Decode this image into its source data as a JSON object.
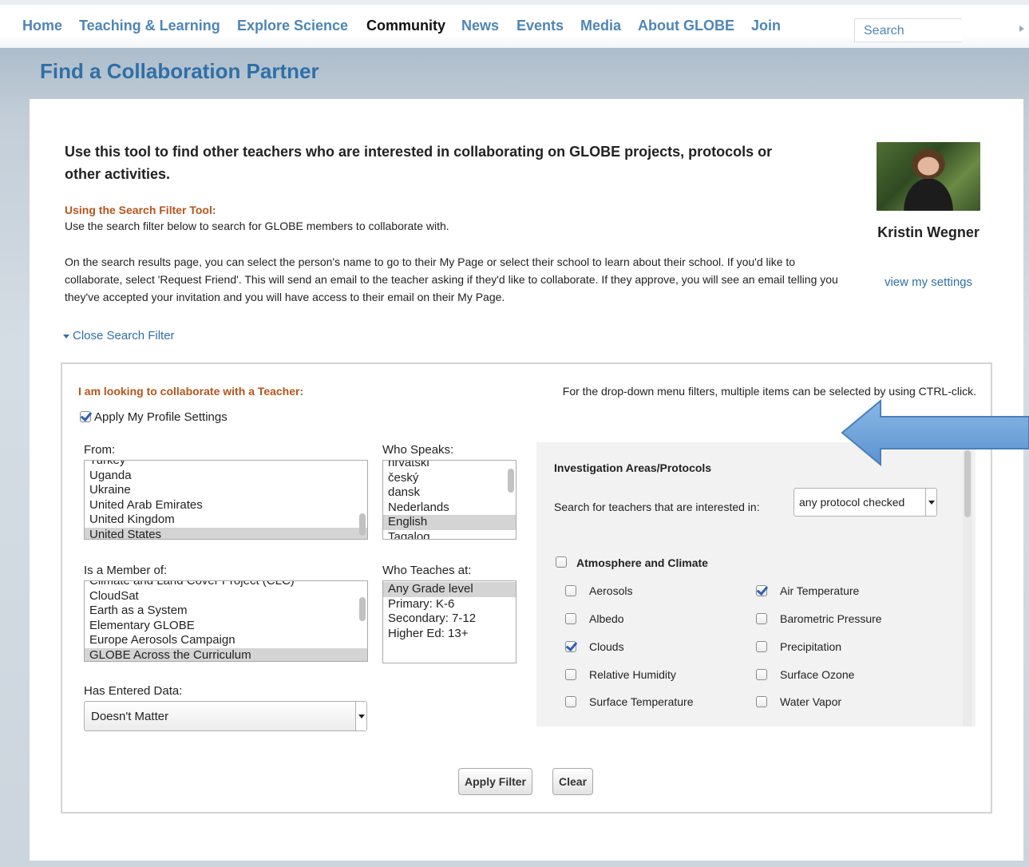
{
  "nav": {
    "items": [
      "Home",
      "Teaching & Learning",
      "Explore Science",
      "Community",
      "News",
      "Events",
      "Media",
      "About GLOBE",
      "Join"
    ],
    "active": "Community",
    "search_placeholder": "Search"
  },
  "page_title": "Find a Collaboration Partner",
  "intro": {
    "heading": "Use this tool to find other teachers who are interested in collaborating on GLOBE projects, protocols or other activities.",
    "filter_tool_title": "Using the Search Filter Tool:",
    "filter_tool_text": "Use the search filter below to search for GLOBE members to collaborate with.",
    "results_text": "On the search results page, you can select the person's name to go to their My Page or select their school to learn about their school. If you'd like to collaborate, select 'Request Friend'. This will send an email to the teacher asking if they'd like to collaborate. If they approve, you will see an email telling you they've accepted your invitation and you will have access to their email on their My Page."
  },
  "profile": {
    "name": "Kristin Wegner",
    "settings_link": "view my settings"
  },
  "close_filter_label": "Close Search Filter",
  "filter": {
    "heading": "I am looking to collaborate with a Teacher:",
    "hint": "For the drop-down menu filters, multiple items can be selected by using CTRL-click.",
    "apply_profile_label": "Apply My Profile Settings",
    "apply_profile_checked": true,
    "from": {
      "label": "From:",
      "options": [
        "Turkey",
        "Uganda",
        "Ukraine",
        "United Arab Emirates",
        "United Kingdom",
        "United States"
      ],
      "selected": "United States"
    },
    "speaks": {
      "label": "Who Speaks:",
      "options": [
        "hrvatski",
        "český",
        "dansk",
        "Nederlands",
        "English",
        "Tagalog"
      ],
      "selected": "English"
    },
    "member": {
      "label": "Is a Member of:",
      "options": [
        "Climate and Land Cover Project (CLC)",
        "CloudSat",
        "Earth as a System",
        "Elementary GLOBE",
        "Europe Aerosols Campaign",
        "GLOBE Across the Curriculum"
      ],
      "selected": "GLOBE Across the Curriculum"
    },
    "teaches": {
      "label": "Who Teaches at:",
      "options": [
        "Any Grade level",
        "Primary: K-6",
        "Secondary: 7-12",
        "Higher Ed: 13+"
      ],
      "selected": "Any Grade level"
    },
    "entered_data": {
      "label": "Has Entered Data:",
      "value": "Doesn't Matter"
    },
    "protocols": {
      "title": "Investigation Areas/Protocols",
      "search_label": "Search for teachers that are interested in:",
      "search_value": "any protocol checked",
      "group": "Atmosphere and Climate",
      "group_checked": false,
      "items": [
        {
          "label": "Aerosols",
          "checked": false
        },
        {
          "label": "Air Temperature",
          "checked": true
        },
        {
          "label": "Albedo",
          "checked": false
        },
        {
          "label": "Barometric Pressure",
          "checked": false
        },
        {
          "label": "Clouds",
          "checked": true
        },
        {
          "label": "Precipitation",
          "checked": false
        },
        {
          "label": "Relative Humidity",
          "checked": false
        },
        {
          "label": "Surface Ozone",
          "checked": false
        },
        {
          "label": "Surface Temperature",
          "checked": false
        },
        {
          "label": "Water Vapor",
          "checked": false
        }
      ]
    },
    "apply_button": "Apply Filter",
    "clear_button": "Clear"
  },
  "colors": {
    "link_blue": "#2f6fa6",
    "nav_blue": "#4e86b6",
    "heading_orange": "#b5551d",
    "arrow_blue": "#6aa0d8"
  }
}
